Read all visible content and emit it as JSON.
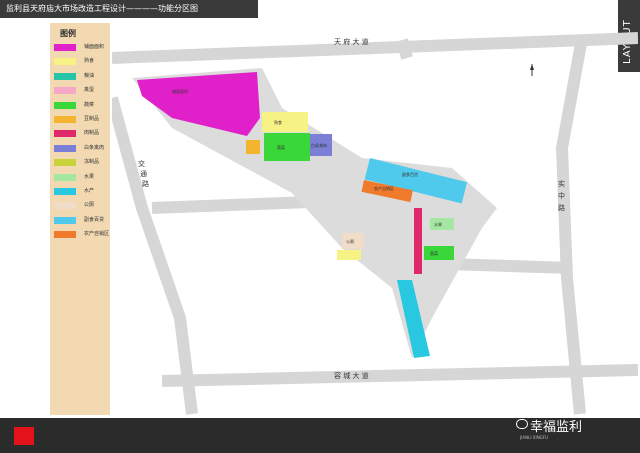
{
  "header": {
    "title": "监利县天府庙大市场改造工程设计————功能分区图",
    "tab": "LAYOUT"
  },
  "legend": {
    "title": "图例",
    "items": [
      {
        "label": "铺面面积",
        "color": "#e020c8"
      },
      {
        "label": "熟食",
        "color": "#f6f384"
      },
      {
        "label": "粮油",
        "color": "#27c4a8"
      },
      {
        "label": "禽蛋",
        "color": "#f4a7c7"
      },
      {
        "label": "蔬菜",
        "color": "#39d739"
      },
      {
        "label": "豆制品",
        "color": "#f4b52e"
      },
      {
        "label": "肉制品",
        "color": "#e0286b"
      },
      {
        "label": "白条禽肉",
        "color": "#7b7fd6"
      },
      {
        "label": "冻制品",
        "color": "#c8d23a"
      },
      {
        "label": "水果",
        "color": "#a6e6a3"
      },
      {
        "label": "水产",
        "color": "#27c8e0"
      },
      {
        "label": "公厕",
        "color": "#f1dcc7"
      },
      {
        "label": "副食百货",
        "color": "#4fc9ec"
      },
      {
        "label": "农产自销区",
        "color": "#f07a2c"
      }
    ]
  },
  "roads": {
    "north": "天 府 大 道",
    "south": "容 城 大 道",
    "west": [
      "交",
      "通",
      "路"
    ],
    "east": [
      "实",
      "中",
      "路"
    ]
  },
  "blocks": {
    "shop": "铺面面积",
    "deli": "熟食",
    "veg1": "蔬菜",
    "veg2": "蔬菜",
    "meat": "肉制品",
    "poultry": "白条禽肉",
    "fruit": "水果",
    "aquatic": "水产",
    "grocery": "副食百货",
    "farm": "农产自销区",
    "toilet": "公厕"
  },
  "footer": {
    "watermark": "幸福监利",
    "watermark_sub": "JIANLI XINGFU"
  },
  "colors": {
    "dark": "#3a3a3a",
    "accent": "#e3121b",
    "legend_bg": "#f2d9b1",
    "road": "#d6d6d6"
  }
}
